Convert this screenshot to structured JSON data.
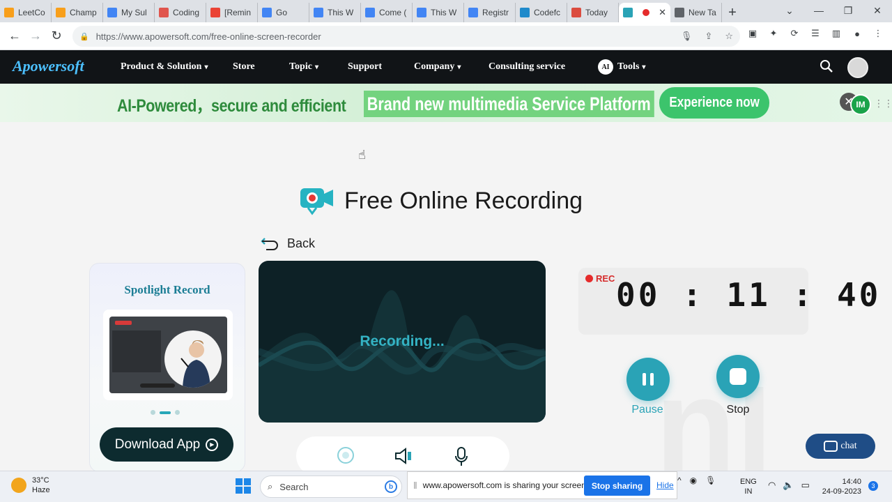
{
  "browser": {
    "tabs": [
      {
        "label": "LeetCo",
        "favicon": "leetcode-icon",
        "color": "#f89f1b"
      },
      {
        "label": "Champ",
        "favicon": "leetcode-icon",
        "color": "#f89f1b"
      },
      {
        "label": "My Sul",
        "favicon": "gear-icon",
        "color": "#4285f4"
      },
      {
        "label": "Coding",
        "favicon": "book-icon",
        "color": "#e0554d"
      },
      {
        "label": "[Remin",
        "favicon": "gmail-icon",
        "color": "#ea4335"
      },
      {
        "label": "Go",
        "favicon": "google-icon",
        "color": "#4285f4"
      },
      {
        "label": "This W",
        "favicon": "google-icon",
        "color": "#4285f4"
      },
      {
        "label": "Come (",
        "favicon": "google-icon",
        "color": "#4285f4"
      },
      {
        "label": "This W",
        "favicon": "google-icon",
        "color": "#4285f4"
      },
      {
        "label": "Registr",
        "favicon": "google-icon",
        "color": "#4285f4"
      },
      {
        "label": "Codefc",
        "favicon": "codeforces-icon",
        "color": "#1f8acb"
      },
      {
        "label": "Today",
        "favicon": "todoist-icon",
        "color": "#db4c3f"
      },
      {
        "label": "",
        "favicon": "apowersoft-icon",
        "color": "#2aa3b6"
      },
      {
        "label": "New Ta",
        "favicon": "chrome-icon",
        "color": "#5f6368"
      }
    ],
    "url": "https://www.apowersoft.com/free-online-screen-recorder"
  },
  "site": {
    "logo": "Apowersoft",
    "nav": {
      "product": "Product & Solution",
      "store": "Store",
      "topic": "Topic",
      "support": "Support",
      "company": "Company",
      "consulting": "Consulting service",
      "tools": "Tools",
      "tools_badge": "AI"
    }
  },
  "banner": {
    "text1": "AI-Powered，secure and efficient",
    "text2": "Brand new multimedia Service Platform",
    "cta": "Experience now",
    "badge": "IM"
  },
  "main": {
    "title": "Free Online Recording",
    "back": "Back",
    "spotlight": {
      "title": "Spotlight Record",
      "download": "Download App"
    },
    "recording_status": "Recording...",
    "rec_label": "REC",
    "timer": "00:11:40",
    "pause": "Pause",
    "stop": "Stop",
    "chat": "chat"
  },
  "taskbar": {
    "temperature": "33°C",
    "weather": "Haze",
    "search_placeholder": "Search",
    "share_message": "www.apowersoft.com is sharing your screen.",
    "stop_sharing": "Stop sharing",
    "hide": "Hide",
    "lang1": "ENG",
    "lang2": "IN",
    "time": "14:40",
    "date": "24-09-2023",
    "notifications": "3"
  },
  "colors": {
    "accent": "#2aa3b6",
    "header_bg": "#111417",
    "banner_green": "#3cc46c",
    "rec_red": "#e52b2b"
  }
}
